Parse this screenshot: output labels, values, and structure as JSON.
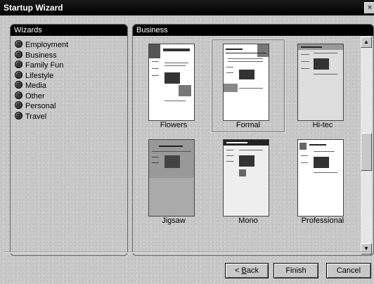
{
  "window": {
    "title": "Startup Wizard",
    "close_glyph": "×"
  },
  "wizards_panel": {
    "header": "Wizards",
    "items": [
      "Employment",
      "Business",
      "Family Fun",
      "Lifestyle",
      "Media",
      "Other",
      "Personal",
      "Travel"
    ]
  },
  "templates_panel": {
    "header": "Business",
    "templates": [
      {
        "label": "Flowers",
        "selected": false
      },
      {
        "label": "Formal",
        "selected": true
      },
      {
        "label": "Hi-tec",
        "selected": false
      },
      {
        "label": "Jigsaw",
        "selected": false
      },
      {
        "label": "Mono",
        "selected": false
      },
      {
        "label": "Professional",
        "selected": false
      }
    ]
  },
  "buttons": {
    "back_prefix": "< ",
    "back_key": "B",
    "back_rest": "ack",
    "finish": "Finish",
    "cancel": "Cancel"
  },
  "icons": {
    "scroll_up": "scroll-up-arrow-icon",
    "scroll_down": "scroll-down-arrow-icon",
    "bullet": "bullet-icon"
  }
}
